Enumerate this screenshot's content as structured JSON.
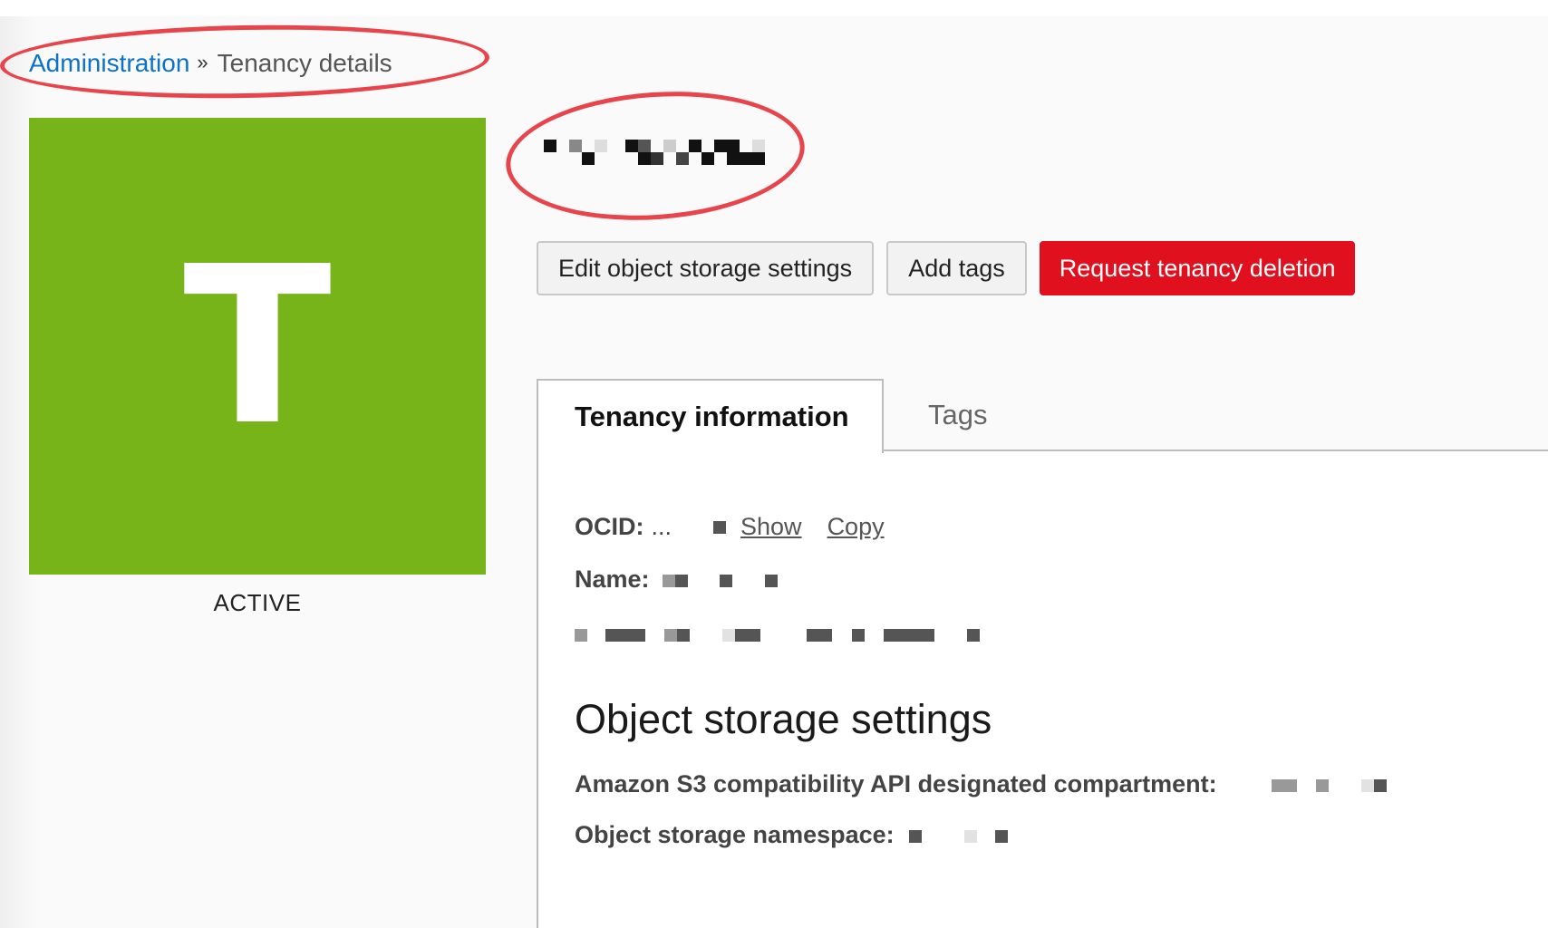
{
  "breadcrumb": {
    "parent_label": "Administration",
    "separator": "»",
    "current_label": "Tenancy details"
  },
  "tenancy": {
    "avatar_letter": "T",
    "avatar_color": "#77b41a",
    "status": "ACTIVE"
  },
  "actions": {
    "edit_storage_label": "Edit object storage settings",
    "add_tags_label": "Add tags",
    "request_deletion_label": "Request tenancy deletion",
    "danger_color": "#e0101e"
  },
  "tabs": [
    {
      "label": "Tenancy information",
      "active": true
    },
    {
      "label": "Tags",
      "active": false
    }
  ],
  "info": {
    "ocid_label": "OCID:",
    "ocid_value": "...",
    "show_label": "Show",
    "copy_label": "Copy",
    "name_label": "Name:"
  },
  "object_storage": {
    "heading": "Object storage settings",
    "s3_compartment_label": "Amazon S3 compatibility API designated compartment:",
    "namespace_label": "Object storage namespace:"
  },
  "annotation_color": "#e8444b"
}
